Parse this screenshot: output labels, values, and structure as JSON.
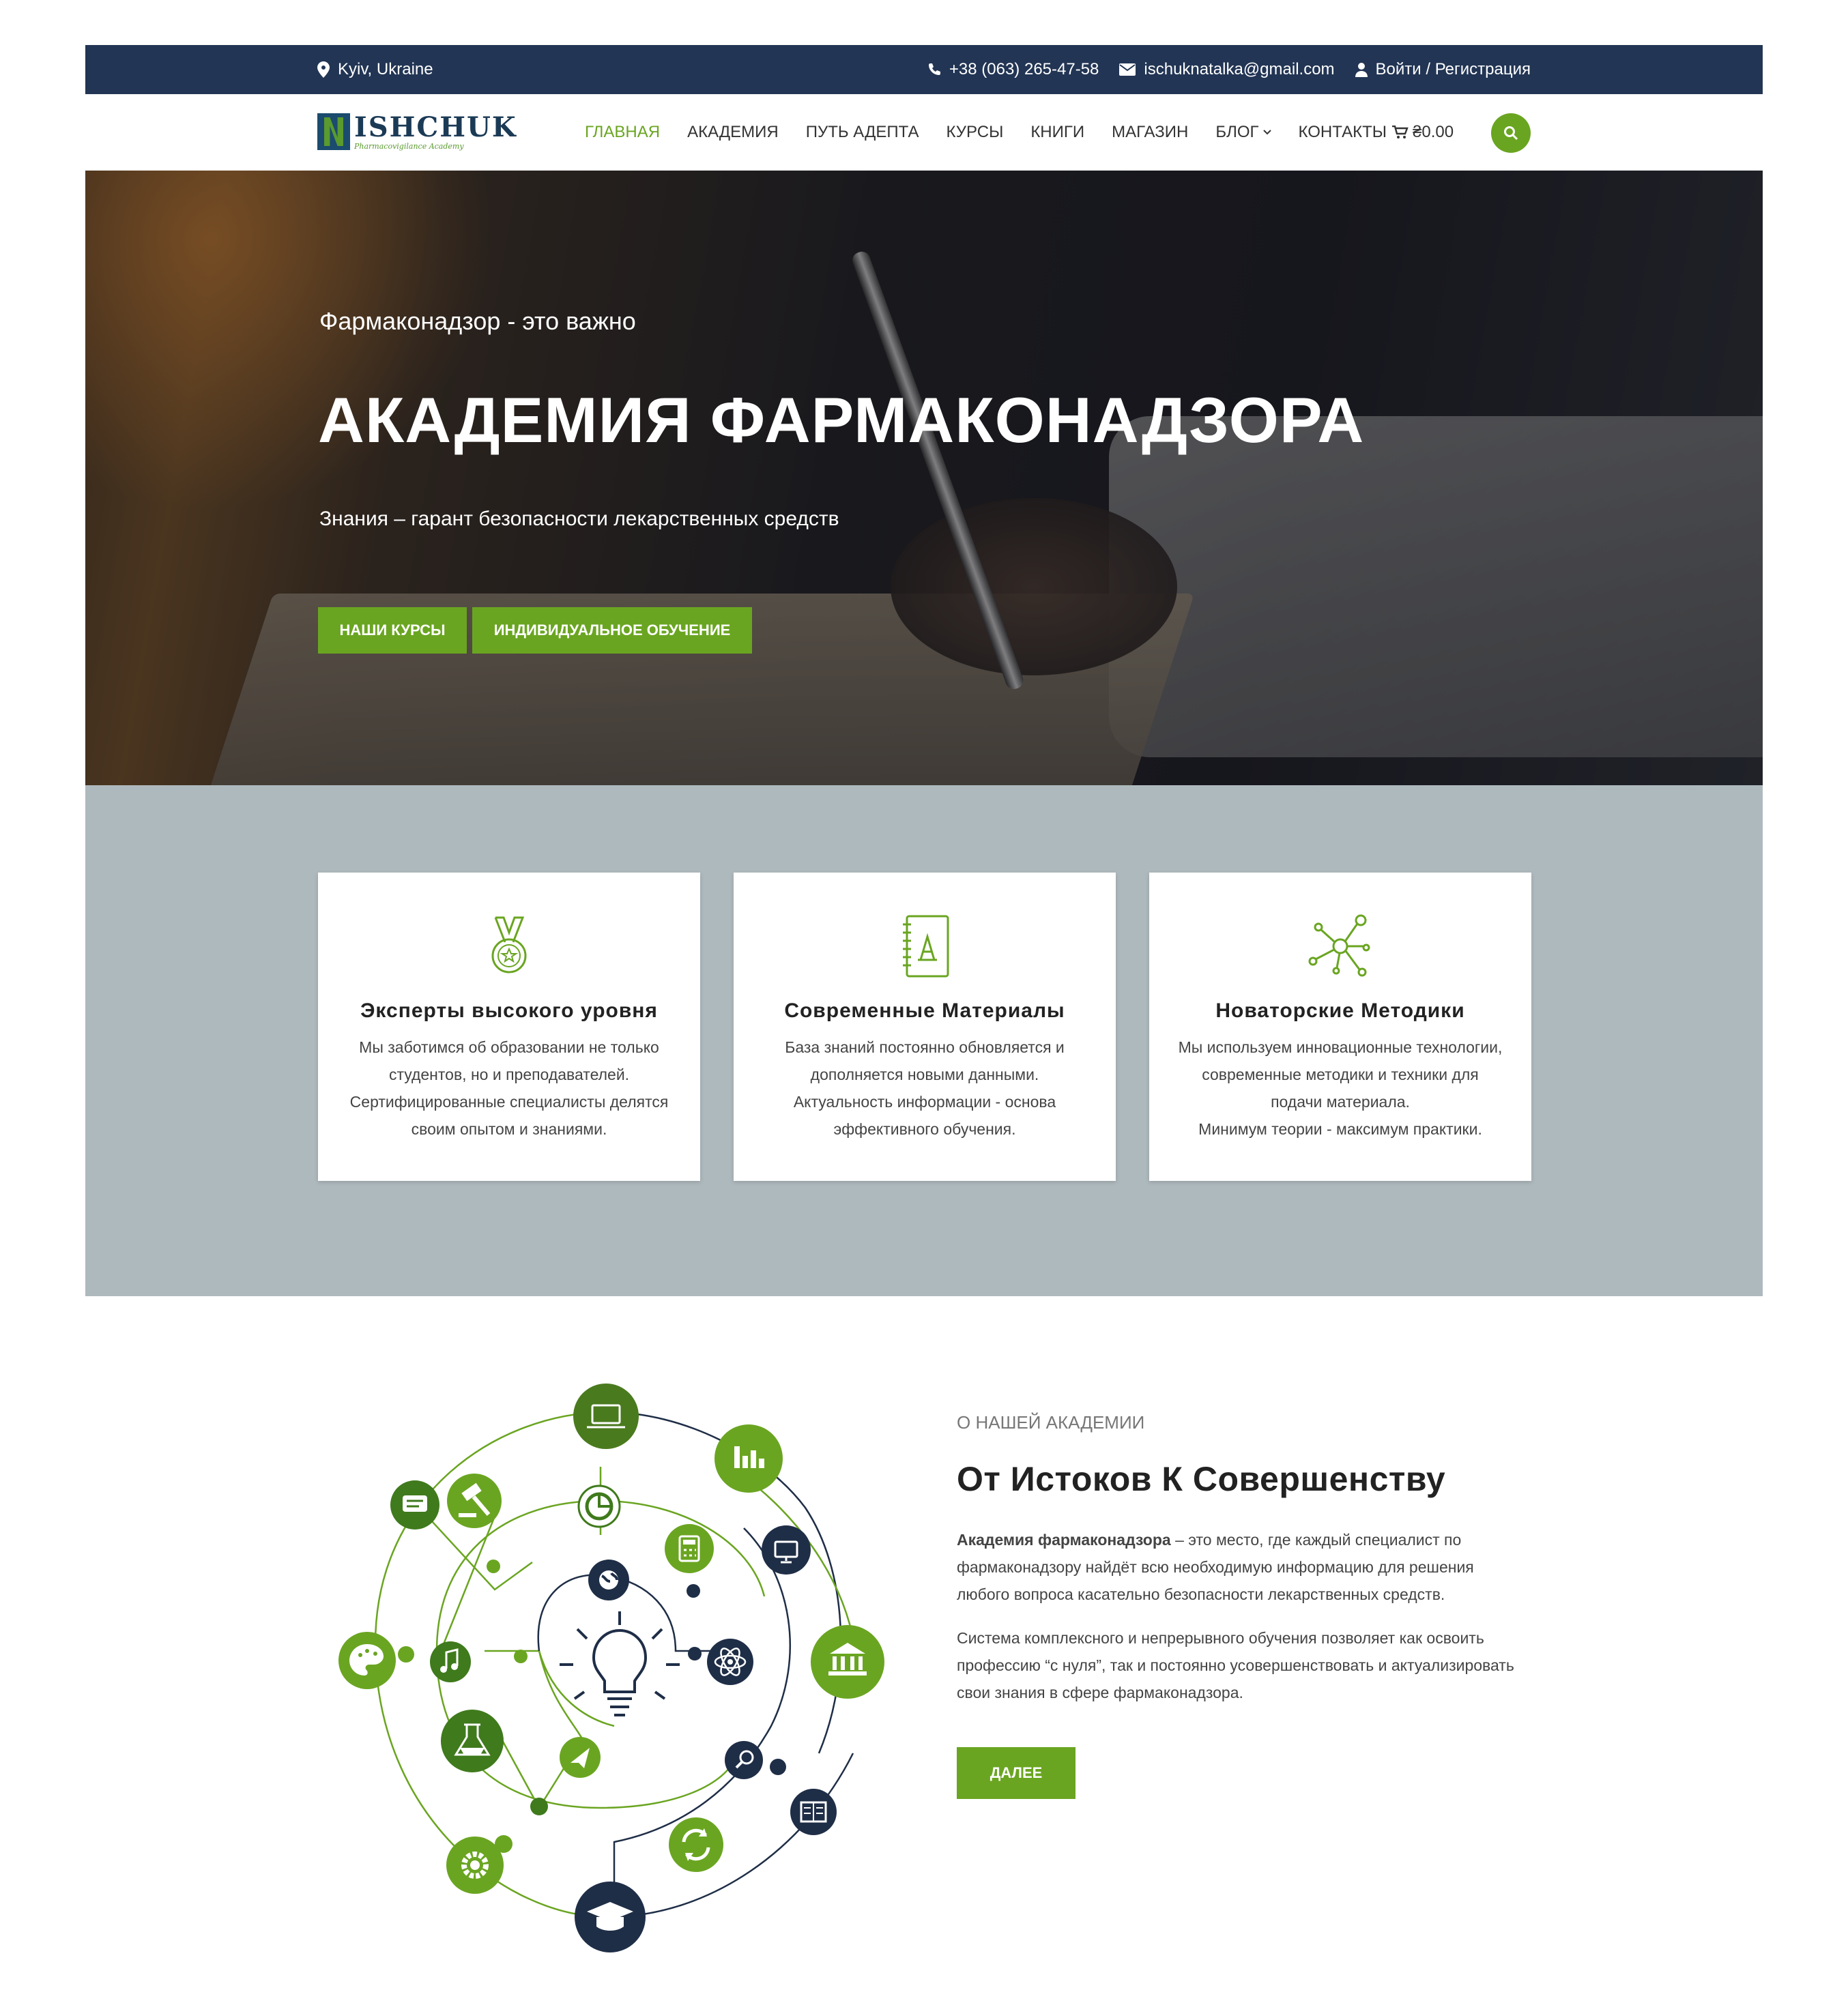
{
  "topbar": {
    "location": "Kyiv, Ukraine",
    "phone": "+38 (063) 265-47-58",
    "email": "ischuknatalka@gmail.com",
    "auth": "Войти / Регистрация"
  },
  "logo": {
    "title": "ISHCHUK",
    "subtitle": "Pharmacovigilance Academy"
  },
  "menu": {
    "items": [
      {
        "label": "ГЛАВНАЯ",
        "active": true
      },
      {
        "label": "АКАДЕМИЯ"
      },
      {
        "label": "ПУТЬ АДЕПТА"
      },
      {
        "label": "КУРСЫ"
      },
      {
        "label": "КНИГИ"
      },
      {
        "label": "МАГАЗИН"
      },
      {
        "label": "БЛОГ"
      },
      {
        "label": "КОНТАКТЫ"
      }
    ],
    "cart": "₴0.00"
  },
  "hero": {
    "subtitle": "Фармаконадзор - это важно",
    "title": "АКАДЕМИЯ ФАРМАКОНАДЗОРА",
    "tagline": "Знания – гарант безопасности лекарственных средств",
    "btn_courses": "НАШИ КУРСЫ",
    "btn_individual": "ИНДИВИДУАЛЬНОЕ ОБУЧЕНИЕ"
  },
  "features": [
    {
      "title": "Эксперты высокого уровня",
      "lines": [
        "Мы заботимся об образовании не только",
        "студентов, но и преподавателей.",
        "Сертифицированные специалисты делятся",
        "своим опытом и знаниями."
      ]
    },
    {
      "title": "Современные Материалы",
      "lines": [
        "База знаний постоянно обновляется и",
        "дополняется новыми данными.",
        "Актуальность информации - основа",
        "эффективного обучения."
      ]
    },
    {
      "title": "Новаторские Методики",
      "lines": [
        "Мы используем инновационные технологии,",
        "современные методики и техники для",
        "подачи материала.",
        "Минимум теории - максимум практики."
      ]
    }
  ],
  "about": {
    "kicker": "О НАШЕЙ АКАДЕМИИ",
    "title": "От Истоков К Совершенству",
    "p1_bold": "Академия фармаконадзора",
    "p1_rest": " – это место, где каждый специалист по фармаконадзору найдёт всю необходимую информацию для решения любого вопроса касательно безопасности лекарственных средств.",
    "p2": "Система комплексного и непрерывного обучения позволяет как освоить профессию “с нуля”, так и постоянно усовершенствовать и актуализировать свои знания в сфере фармаконадзора.",
    "btn": "ДАЛЕЕ"
  },
  "colors": {
    "accent": "#6aa521",
    "topbar": "#223554",
    "features_bg": "#aeb9bd",
    "dark_icon": "#1f2e47"
  }
}
